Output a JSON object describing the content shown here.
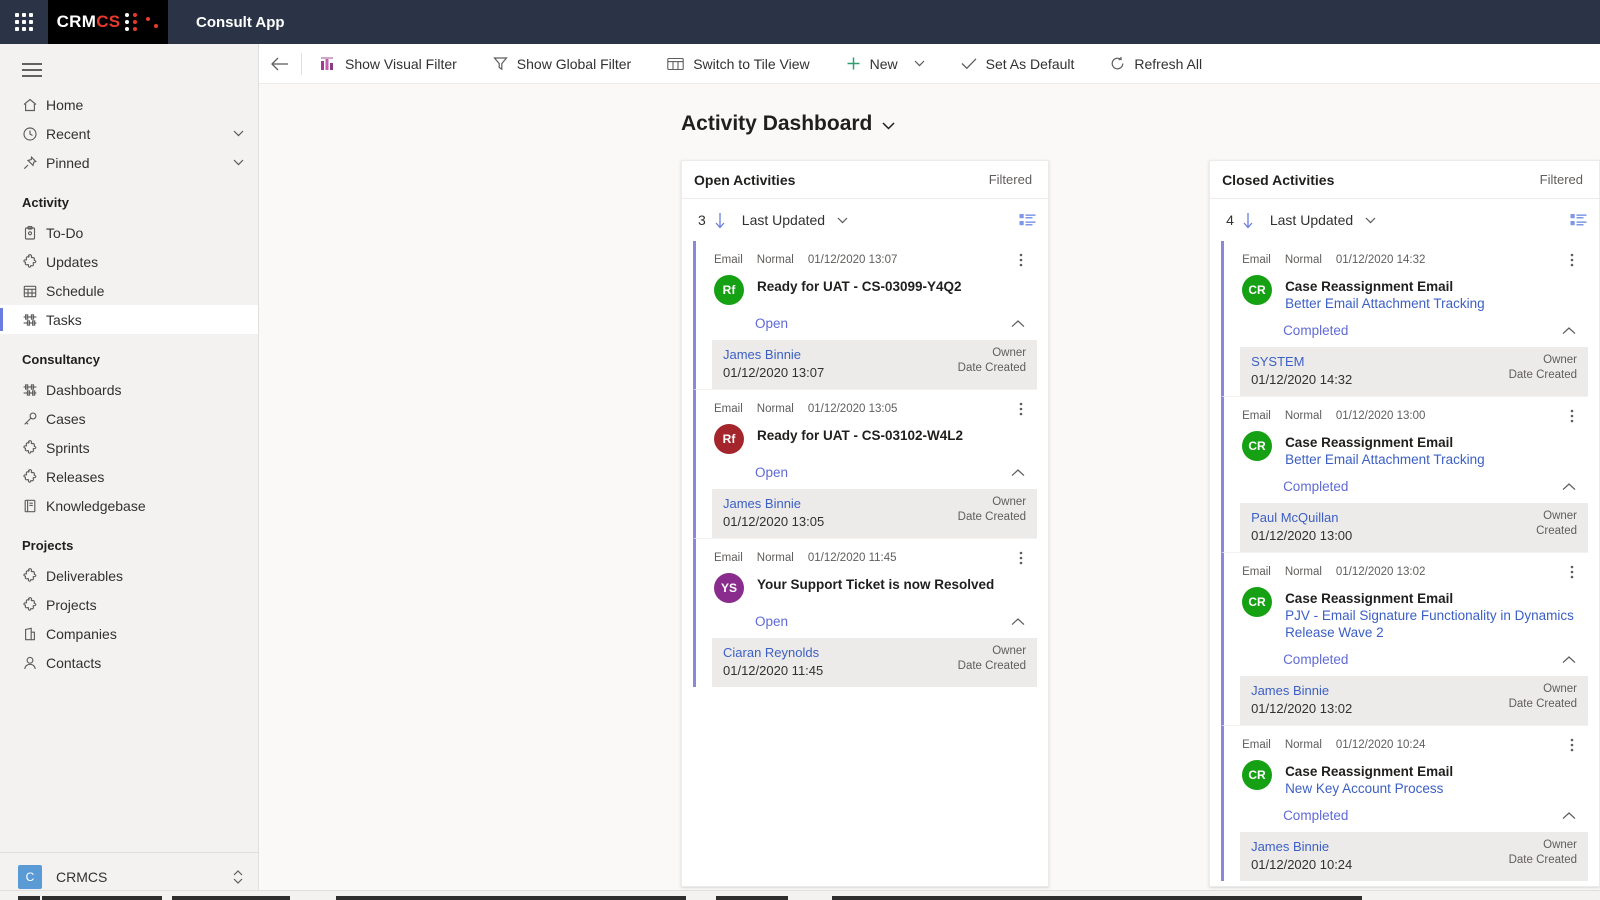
{
  "topbar": {
    "waffle_icon": "app-launcher-icon",
    "brand_prefix": "CRM",
    "brand_suffix": "CS",
    "app_name": "Consult App"
  },
  "sidebar": {
    "hamburger_icon": "hamburger-icon",
    "items": [
      {
        "label": "Home",
        "icon": "home-icon",
        "chevron": false,
        "selected": false
      },
      {
        "label": "Recent",
        "icon": "clock-icon",
        "chevron": true,
        "selected": false
      },
      {
        "label": "Pinned",
        "icon": "pin-icon",
        "chevron": true,
        "selected": false
      }
    ],
    "groups": [
      {
        "title": "Activity",
        "items": [
          {
            "label": "To-Do",
            "icon": "clipboard-icon",
            "selected": false
          },
          {
            "label": "Updates",
            "icon": "puzzle-icon",
            "selected": false
          },
          {
            "label": "Schedule",
            "icon": "calendar-icon",
            "selected": false
          },
          {
            "label": "Tasks",
            "icon": "dashboard-icon",
            "selected": true
          }
        ]
      },
      {
        "title": "Consultancy",
        "items": [
          {
            "label": "Dashboards",
            "icon": "dashboard-icon",
            "selected": false
          },
          {
            "label": "Cases",
            "icon": "key-icon",
            "selected": false
          },
          {
            "label": "Sprints",
            "icon": "puzzle-icon",
            "selected": false
          },
          {
            "label": "Releases",
            "icon": "puzzle-icon",
            "selected": false
          },
          {
            "label": "Knowledgebase",
            "icon": "book-icon",
            "selected": false
          }
        ]
      },
      {
        "title": "Projects",
        "items": [
          {
            "label": "Deliverables",
            "icon": "puzzle-icon",
            "selected": false
          },
          {
            "label": "Projects",
            "icon": "puzzle-icon",
            "selected": false
          },
          {
            "label": "Companies",
            "icon": "building-icon",
            "selected": false
          },
          {
            "label": "Contacts",
            "icon": "person-icon",
            "selected": false
          }
        ]
      }
    ],
    "footer": {
      "avatar_initial": "C",
      "label": "CRMCS",
      "arrows_icon": "up-down-arrows-icon"
    }
  },
  "commandbar": {
    "back_icon": "back-arrow-icon",
    "buttons": [
      {
        "label": "Show Visual Filter",
        "icon": "chart-icon",
        "dropdown": false
      },
      {
        "label": "Show Global Filter",
        "icon": "funnel-icon",
        "dropdown": false
      },
      {
        "label": "Switch to Tile View",
        "icon": "tiles-icon",
        "dropdown": false
      },
      {
        "label": "New",
        "icon": "plus-icon",
        "dropdown": true
      },
      {
        "label": "Set As Default",
        "icon": "check-icon",
        "dropdown": false
      },
      {
        "label": "Refresh All",
        "icon": "refresh-icon",
        "dropdown": false
      }
    ]
  },
  "dashboard": {
    "title": "Activity Dashboard",
    "title_chevron_icon": "chevron-down-icon"
  },
  "colors": {
    "accent_bar": "#8b87de",
    "link": "#3b5fc4",
    "status": "#5f6ad6",
    "topbar_bg": "#2b3447",
    "brand_red": "#e8392f",
    "avatar_green": "#16a013",
    "avatar_darkred": "#a4262c",
    "avatar_purple": "#8a2c8e"
  },
  "cards": [
    {
      "title": "Open Activities",
      "filtered_label": "Filtered",
      "count": "3",
      "sort_arrow_icon": "arrow-down-icon",
      "sort_label": "Last Updated",
      "sort_chevron_icon": "chevron-down-icon",
      "view_icon": "list-view-icon",
      "activities": [
        {
          "type": "Email",
          "priority": "Normal",
          "timestamp": "01/12/2020 13:07",
          "kebab_icon": "more-vertical-icon",
          "avatar_initials": "Rf",
          "avatar_color": "#16a013",
          "subject": "Ready for UAT - CS-03099-Y4Q2",
          "regarding": "",
          "status": "Open",
          "collapse_icon": "chevron-up-icon",
          "owner": "James Binnie",
          "owner_label": "Owner",
          "date": "01/12/2020 13:07",
          "date_label": "Date Created"
        },
        {
          "type": "Email",
          "priority": "Normal",
          "timestamp": "01/12/2020 13:05",
          "kebab_icon": "more-vertical-icon",
          "avatar_initials": "Rf",
          "avatar_color": "#a4262c",
          "subject": "Ready for UAT - CS-03102-W4L2",
          "regarding": "",
          "status": "Open",
          "collapse_icon": "chevron-up-icon",
          "owner": "James Binnie",
          "owner_label": "Owner",
          "date": "01/12/2020 13:05",
          "date_label": "Date Created"
        },
        {
          "type": "Email",
          "priority": "Normal",
          "timestamp": "01/12/2020 11:45",
          "kebab_icon": "more-vertical-icon",
          "avatar_initials": "YS",
          "avatar_color": "#8a2c8e",
          "subject": "Your Support Ticket is now Resolved",
          "regarding": "",
          "status": "Open",
          "collapse_icon": "chevron-up-icon",
          "owner": "Ciaran Reynolds",
          "owner_label": "Owner",
          "date": "01/12/2020 11:45",
          "date_label": "Date Created"
        }
      ]
    },
    {
      "title": "Closed Activities",
      "filtered_label": "Filtered",
      "count": "4",
      "sort_arrow_icon": "arrow-down-icon",
      "sort_label": "Last Updated",
      "sort_chevron_icon": "chevron-down-icon",
      "view_icon": "list-view-icon",
      "activities": [
        {
          "type": "Email",
          "priority": "Normal",
          "timestamp": "01/12/2020 14:32",
          "kebab_icon": "more-vertical-icon",
          "avatar_initials": "CR",
          "avatar_color": "#16a013",
          "subject": "Case Reassignment Email",
          "regarding": "Better Email Attachment Tracking",
          "status": "Completed",
          "collapse_icon": "chevron-up-icon",
          "owner": "SYSTEM",
          "owner_label": "Owner",
          "date": "01/12/2020 14:32",
          "date_label": "Date Created"
        },
        {
          "type": "Email",
          "priority": "Normal",
          "timestamp": "01/12/2020 13:00",
          "kebab_icon": "more-vertical-icon",
          "avatar_initials": "CR",
          "avatar_color": "#16a013",
          "subject": "Case Reassignment Email",
          "regarding": "Better Email Attachment Tracking",
          "status": "Completed",
          "collapse_icon": "chevron-up-icon",
          "owner": "Paul McQuillan",
          "owner_label": "Owner",
          "date": "01/12/2020 13:00",
          "date_label": "Created"
        },
        {
          "type": "Email",
          "priority": "Normal",
          "timestamp": "01/12/2020 13:02",
          "kebab_icon": "more-vertical-icon",
          "avatar_initials": "CR",
          "avatar_color": "#16a013",
          "subject": "Case Reassignment Email",
          "regarding": "PJV - Email Signature Functionality in Dynamics Release Wave 2",
          "status": "Completed",
          "collapse_icon": "chevron-up-icon",
          "owner": "James Binnie",
          "owner_label": "Owner",
          "date": "01/12/2020 13:02",
          "date_label": "Date Created"
        },
        {
          "type": "Email",
          "priority": "Normal",
          "timestamp": "01/12/2020 10:24",
          "kebab_icon": "more-vertical-icon",
          "avatar_initials": "CR",
          "avatar_color": "#16a013",
          "subject": "Case Reassignment Email",
          "regarding": "New Key Account Process",
          "status": "Completed",
          "collapse_icon": "chevron-up-icon",
          "owner": "James Binnie",
          "owner_label": "Owner",
          "date": "01/12/2020 10:24",
          "date_label": "Date Created"
        }
      ]
    }
  ]
}
